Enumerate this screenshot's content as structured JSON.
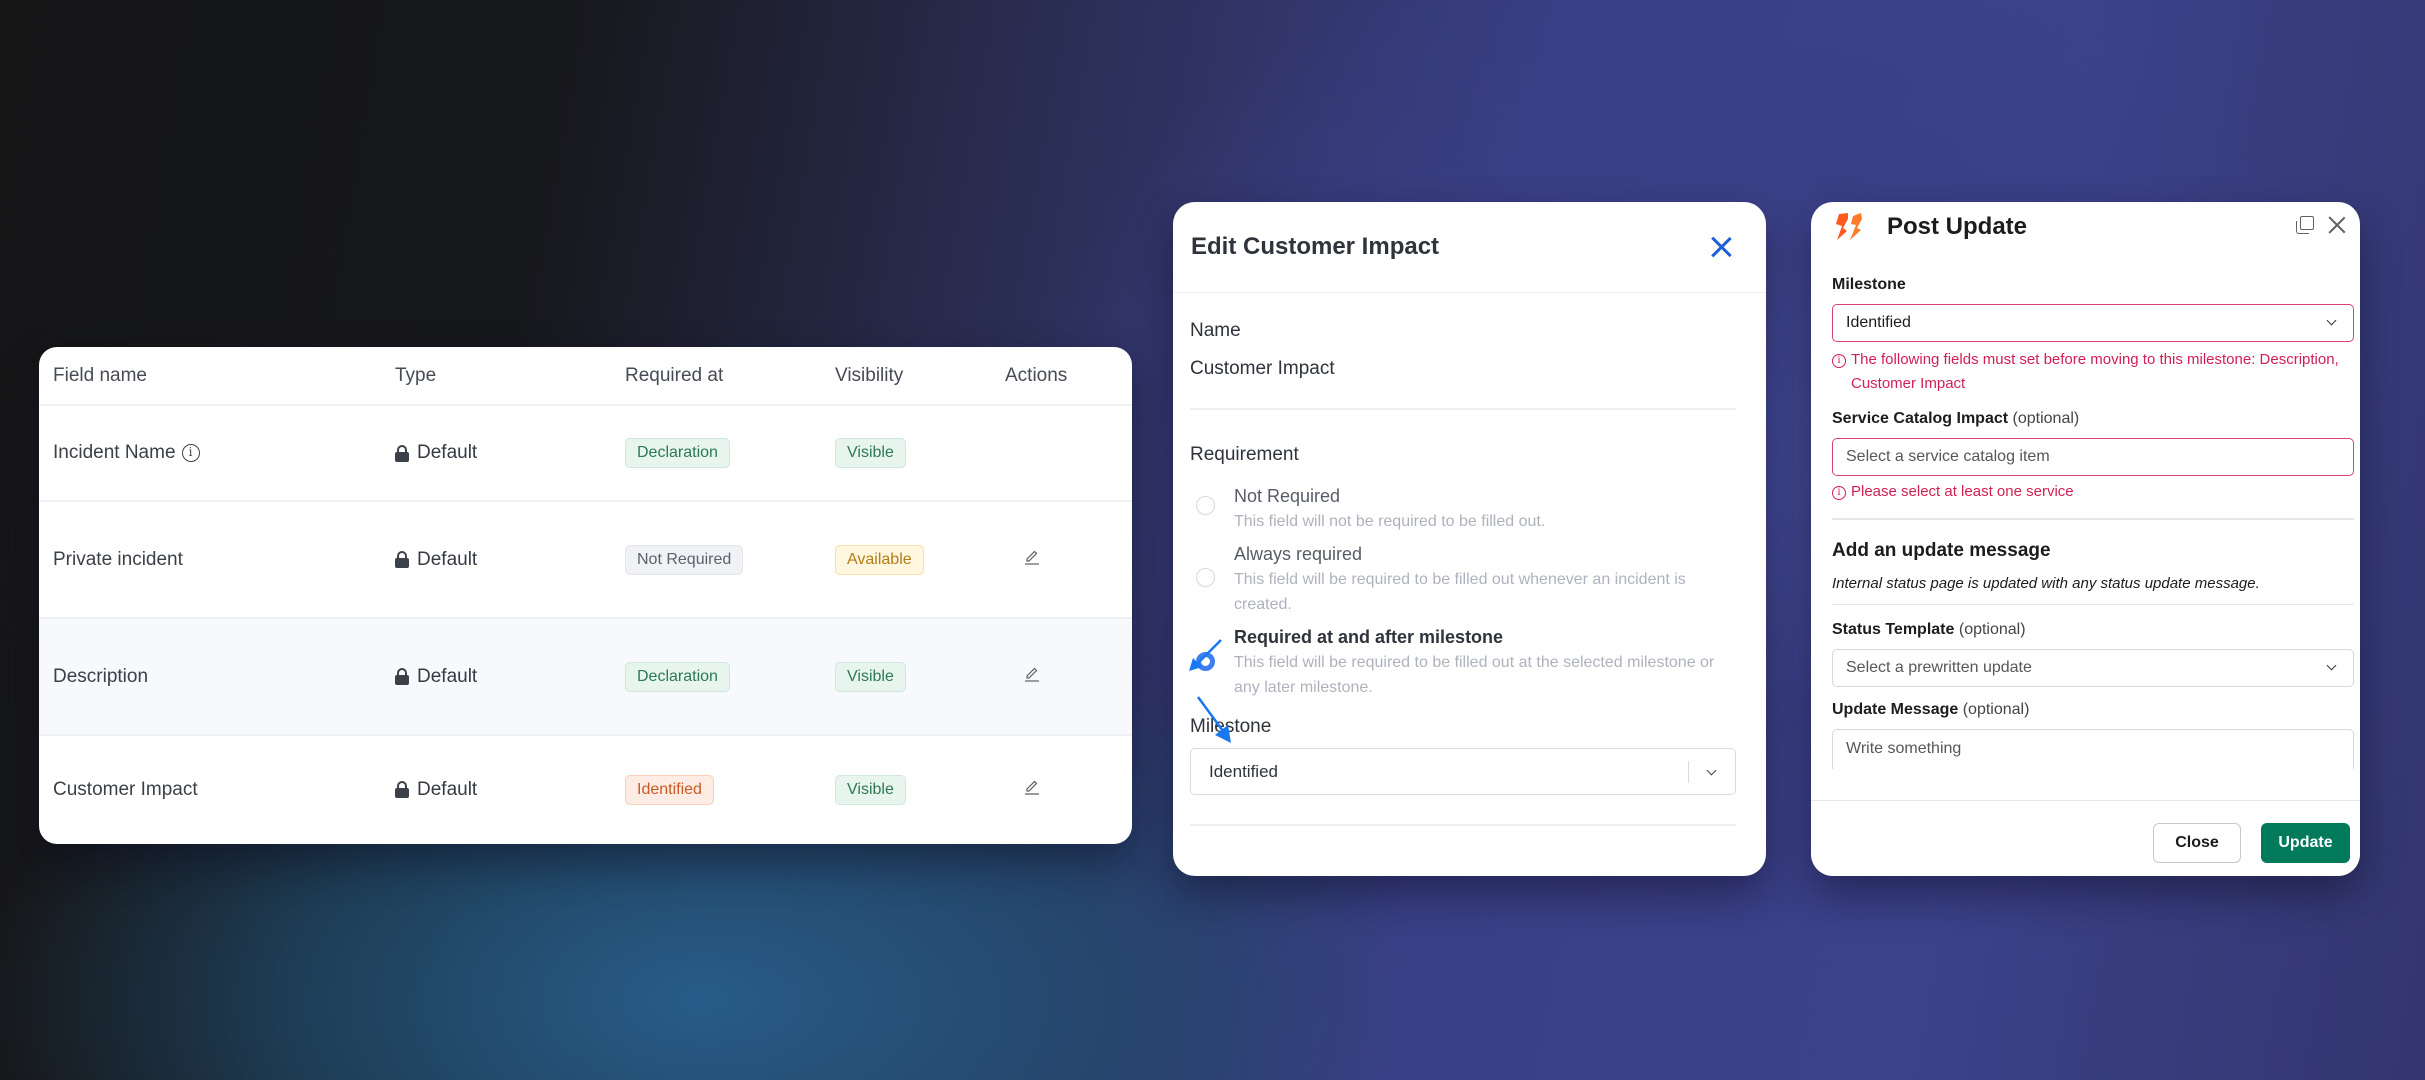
{
  "fields_table": {
    "columns": [
      "Field name",
      "Type",
      "Required at",
      "Visibility",
      "Actions"
    ],
    "rows": [
      {
        "name": "Incident Name",
        "has_info_icon": true,
        "type": "Default",
        "required_at": "Declaration",
        "required_variant": "green",
        "visibility": "Visible",
        "visibility_variant": "green",
        "editable": false
      },
      {
        "name": "Private incident",
        "has_info_icon": false,
        "type": "Default",
        "required_at": "Not Required",
        "required_variant": "gray",
        "visibility": "Available",
        "visibility_variant": "yellow",
        "editable": true
      },
      {
        "name": "Description",
        "has_info_icon": false,
        "type": "Default",
        "required_at": "Declaration",
        "required_variant": "green",
        "visibility": "Visible",
        "visibility_variant": "green",
        "editable": true
      },
      {
        "name": "Customer Impact",
        "has_info_icon": false,
        "type": "Default",
        "required_at": "Identified",
        "required_variant": "orange",
        "visibility": "Visible",
        "visibility_variant": "green",
        "editable": true
      }
    ],
    "info_icon_glyph": "i",
    "lock_icon": "lock-icon",
    "edit_icon": "pencil-icon"
  },
  "edit_modal": {
    "title": "Edit Customer Impact",
    "close_icon": "close-icon",
    "name_label": "Name",
    "name_value": "Customer Impact",
    "requirement_label": "Requirement",
    "options": [
      {
        "title": "Not Required",
        "description": "This field will not be required to be filled out.",
        "checked": false
      },
      {
        "title": "Always required",
        "description": "This field will be required to be filled out whenever an incident is created.",
        "checked": false
      },
      {
        "title": "Required at and after milestone",
        "description": "This field will be required to be filled out at the selected milestone or any later milestone.",
        "checked": true
      }
    ],
    "milestone_label": "Milestone",
    "milestone_value": "Identified",
    "accent_color": "#3f7ff0"
  },
  "post_update": {
    "title": "Post Update",
    "milestone_label": "Milestone",
    "milestone_value": "Identified",
    "milestone_error": "The following fields must set before moving to this milestone: Description, Customer Impact",
    "service_label": "Service Catalog Impact",
    "optional_suffix": "(optional)",
    "service_placeholder": "Select a service catalog item",
    "service_error": "Please select at least one service",
    "update_heading": "Add an update message",
    "update_note": "Internal status page is updated with any status update message.",
    "template_label": "Status Template",
    "template_placeholder": "Select a prewritten update",
    "message_label": "Update Message",
    "message_placeholder": "Write something",
    "close_button": "Close",
    "update_button": "Update",
    "error_color": "#d21f53",
    "primary_color": "#007a5a",
    "brand_color": "#ff5a1f"
  }
}
